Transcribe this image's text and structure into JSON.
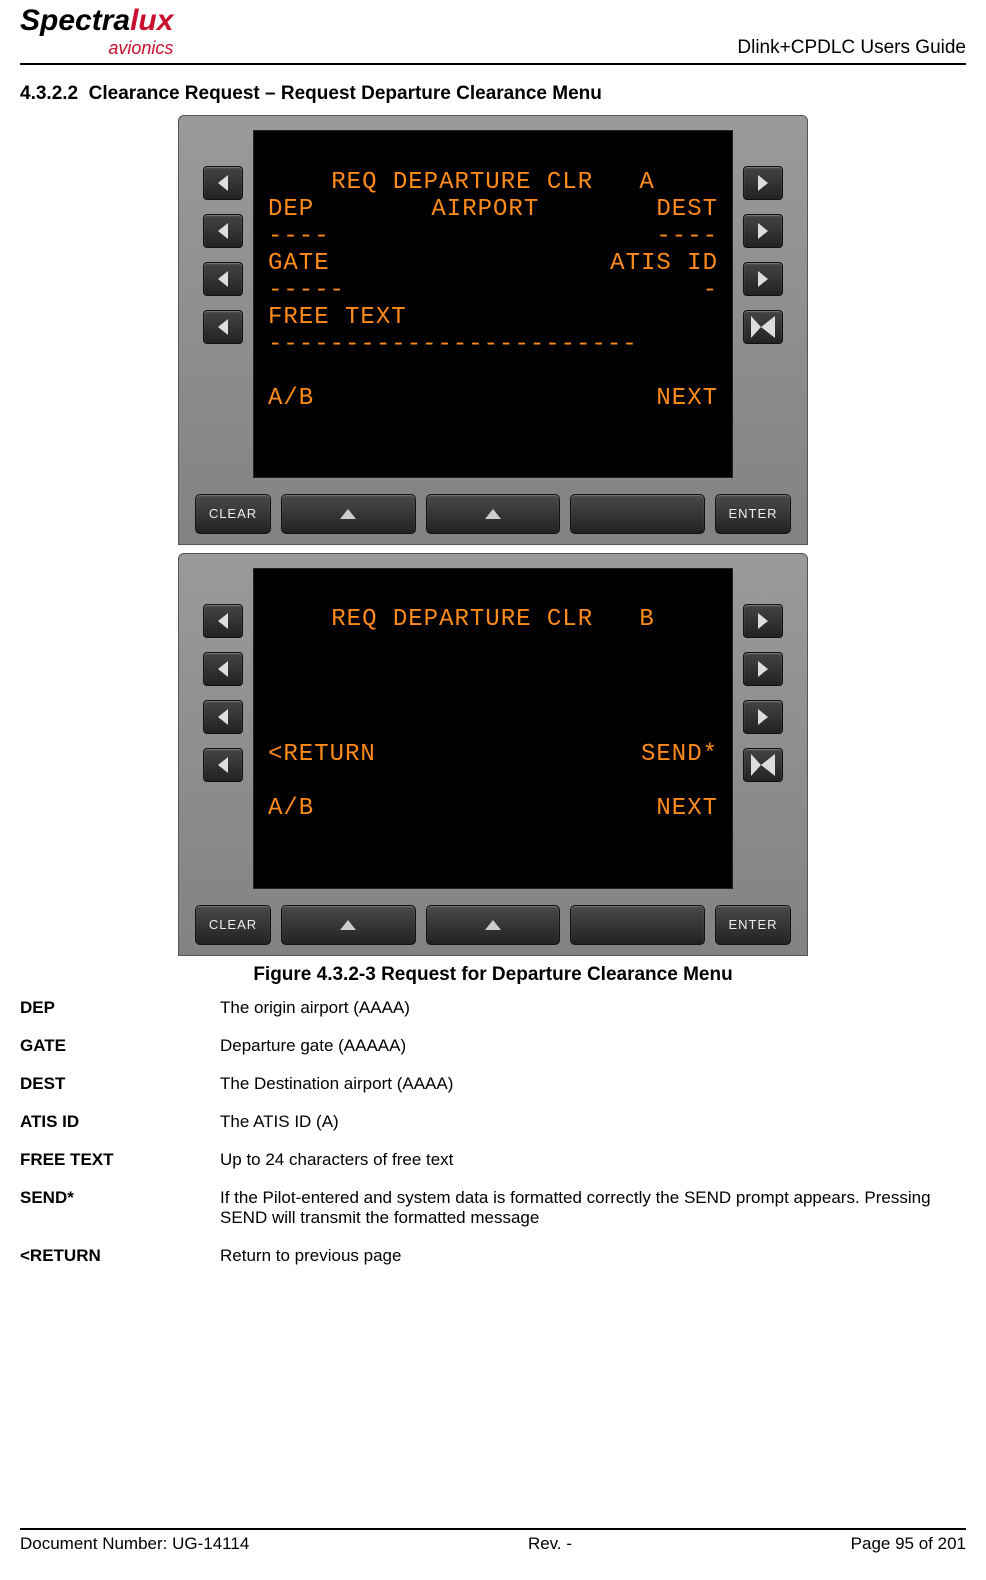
{
  "header": {
    "logo_a": "Spectra",
    "logo_b": "lux",
    "logo_sub": "avionics",
    "doc_title": "Dlink+CPDLC Users Guide"
  },
  "section": {
    "number": "4.3.2.2",
    "title": "Clearance Request – Request Departure Clearance Menu"
  },
  "cdu_a": {
    "title": "REQ DEPARTURE CLR   A",
    "l1_left": "DEP",
    "l1_mid": "AIRPORT",
    "l1_right": "DEST",
    "l2_left": "----",
    "l2_right": "----",
    "l3_left": "GATE",
    "l3_right": "ATIS ID",
    "l4_left": "-----",
    "l4_right": "-",
    "l5": "FREE TEXT",
    "l6": "------------------------",
    "l8_left": "A/B",
    "l8_right": "NEXT"
  },
  "cdu_b": {
    "title": "REQ DEPARTURE CLR   B",
    "l5_left": "<RETURN",
    "l5_right": "SEND*",
    "l7_left": "A/B",
    "l7_right": "NEXT"
  },
  "buttons": {
    "clear": "CLEAR",
    "enter": "ENTER"
  },
  "figure_caption": "Figure 4.3.2-3 Request for Departure Clearance Menu",
  "definitions": [
    {
      "term": "DEP",
      "desc": "The origin airport (AAAA)"
    },
    {
      "term": "GATE",
      "desc": "Departure gate (AAAAA)"
    },
    {
      "term": "DEST",
      "desc": "The Destination airport (AAAA)"
    },
    {
      "term": "ATIS ID",
      "desc": "The ATIS ID (A)"
    },
    {
      "term": "FREE TEXT",
      "desc": "Up to 24 characters of free text"
    },
    {
      "term": "SEND*",
      "desc": "If the Pilot-entered and system data is formatted correctly the SEND prompt appears. Pressing SEND will transmit the formatted message"
    },
    {
      "term": "<RETURN",
      "desc": "Return to previous page"
    }
  ],
  "footer": {
    "left": "Document Number:  UG-14114",
    "center": "Rev. -",
    "right": "Page 95 of 201"
  }
}
